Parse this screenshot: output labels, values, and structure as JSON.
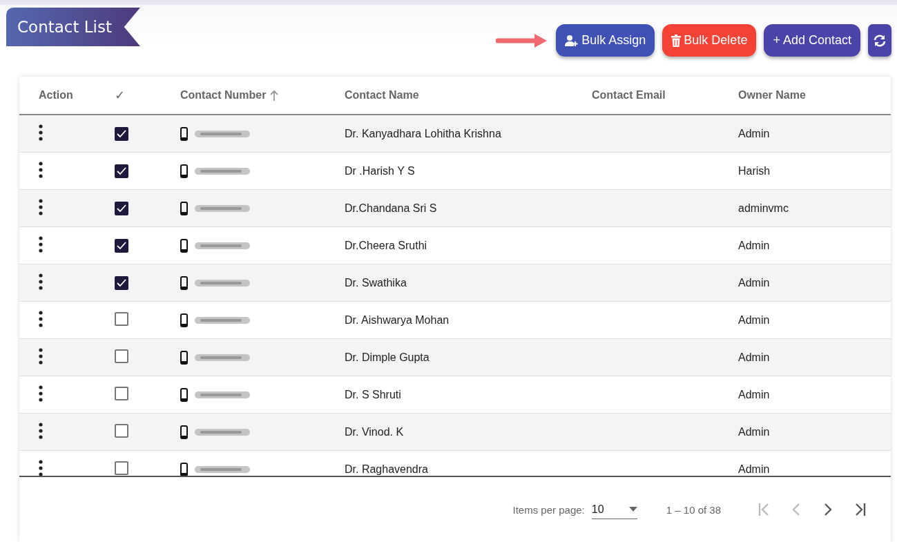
{
  "title": "Contact List",
  "buttons": [
    {
      "kind": "assign",
      "label": "Bulk Assign",
      "pointed": true
    },
    {
      "kind": "delete",
      "label": "Bulk Delete"
    },
    {
      "kind": "add",
      "label": "+ Add Contact"
    },
    {
      "kind": "refresh"
    }
  ],
  "table": {
    "columns": [
      {
        "label": "Action"
      },
      {
        "label": "✓"
      },
      {
        "label": "Contact Number",
        "sorted": true
      },
      {
        "label": "Contact Name"
      },
      {
        "label": "Contact Email"
      },
      {
        "label": "Owner Name"
      }
    ],
    "rows": [
      {
        "checked": true,
        "name": "Dr. Kanyadhara Lohitha Krishna",
        "owner": "Admin"
      },
      {
        "checked": true,
        "name": "Dr .Harish Y S",
        "owner": "Harish"
      },
      {
        "checked": true,
        "name": "Dr.Chandana Sri S",
        "owner": "adminvmc"
      },
      {
        "checked": true,
        "name": "Dr.Cheera Sruthi",
        "owner": "Admin"
      },
      {
        "checked": true,
        "name": "Dr. Swathika",
        "owner": "Admin"
      },
      {
        "checked": false,
        "name": "Dr. Aishwarya Mohan",
        "owner": "Admin"
      },
      {
        "checked": false,
        "name": "Dr. Dimple Gupta",
        "owner": "Admin"
      },
      {
        "checked": false,
        "name": "Dr. S Shruti",
        "owner": "Admin"
      },
      {
        "checked": false,
        "name": "Dr. Vinod. K",
        "owner": "Admin"
      },
      {
        "checked": false,
        "name": "Dr. Raghavendra",
        "owner": "Admin"
      }
    ]
  },
  "paginator": {
    "items_label": "Items per page:",
    "page_size": "10",
    "range": "1 – 10 of 38",
    "first_disabled": true,
    "prev_disabled": true,
    "next_disabled": false,
    "last_disabled": false
  }
}
